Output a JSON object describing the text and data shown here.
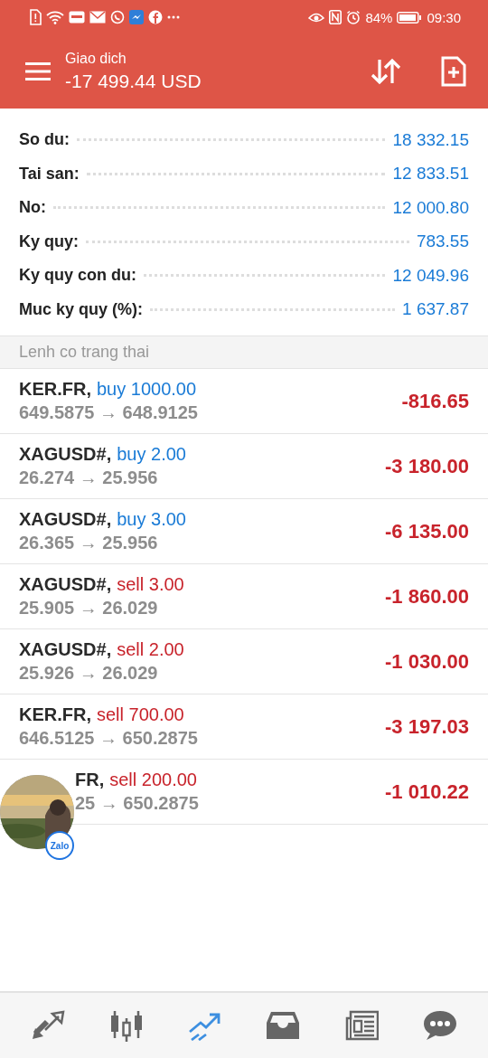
{
  "status_bar": {
    "battery": "84%",
    "time": "09:30"
  },
  "header": {
    "title": "Giao dich",
    "balance": "-17 499.44 USD"
  },
  "summary": [
    {
      "label": "So du:",
      "value": "18 332.15"
    },
    {
      "label": "Tai san:",
      "value": "12 833.51"
    },
    {
      "label": "No:",
      "value": "12 000.80"
    },
    {
      "label": "Ky quy:",
      "value": "783.55"
    },
    {
      "label": "Ky quy con du:",
      "value": "12 049.96"
    },
    {
      "label": "Muc ky quy (%):",
      "value": "1 637.87"
    }
  ],
  "section_title": "Lenh co trang thai",
  "orders": [
    {
      "symbol": "KER.FR,",
      "kind": "buy",
      "action": "buy 1000.00",
      "prices": "649.5875 → 648.9125",
      "profit": "-816.65",
      "covered": false
    },
    {
      "symbol": "XAGUSD#,",
      "kind": "buy",
      "action": "buy 2.00",
      "prices": "26.274 → 25.956",
      "profit": "-3 180.00",
      "covered": false
    },
    {
      "symbol": "XAGUSD#,",
      "kind": "buy",
      "action": "buy 3.00",
      "prices": "26.365 → 25.956",
      "profit": "-6 135.00",
      "covered": false
    },
    {
      "symbol": "XAGUSD#,",
      "kind": "sell",
      "action": "sell 3.00",
      "prices": "25.905 → 26.029",
      "profit": "-1 860.00",
      "covered": false
    },
    {
      "symbol": "XAGUSD#,",
      "kind": "sell",
      "action": "sell 2.00",
      "prices": "25.926 → 26.029",
      "profit": "-1 030.00",
      "covered": false
    },
    {
      "symbol": "KER.FR,",
      "kind": "sell",
      "action": "sell 700.00",
      "prices": "646.5125 → 650.2875",
      "profit": "-3 197.03",
      "covered": false
    },
    {
      "symbol": "FR,",
      "kind": "sell",
      "action": "sell 200.00",
      "prices": "25 → 650.2875",
      "profit": "-1 010.22",
      "covered": true
    }
  ],
  "chat_head": {
    "badge": "Zalo"
  },
  "nav": [
    {
      "kind": "trade",
      "selected": false
    },
    {
      "kind": "chart",
      "selected": false
    },
    {
      "kind": "trend",
      "selected": true
    },
    {
      "kind": "inbox",
      "selected": false
    },
    {
      "kind": "news",
      "selected": false
    },
    {
      "kind": "chat",
      "selected": false
    }
  ]
}
